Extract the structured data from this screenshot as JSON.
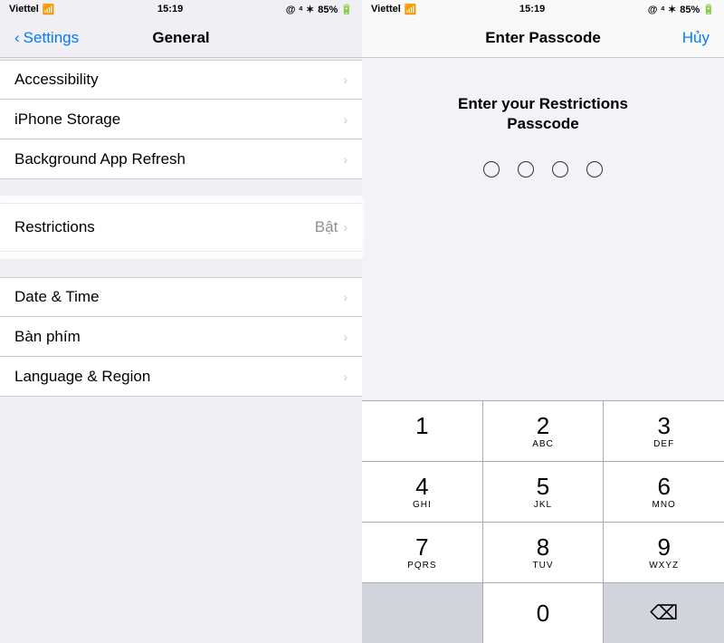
{
  "left": {
    "status": {
      "carrier": "Viettel",
      "time": "15:19",
      "icons": "@ ⁴ ✶ 85%"
    },
    "nav": {
      "back_label": "Settings",
      "title": "General"
    },
    "rows": [
      {
        "id": "accessibility",
        "label": "Accessibility",
        "value": "",
        "chevron": "›"
      },
      {
        "id": "iphone-storage",
        "label": "iPhone Storage",
        "value": "",
        "chevron": "›"
      },
      {
        "id": "background-refresh",
        "label": "Background App Refresh",
        "value": "",
        "chevron": "›"
      }
    ],
    "restrictions": {
      "label": "Restrictions",
      "value": "Bật",
      "chevron": "›"
    },
    "rows2": [
      {
        "id": "date-time",
        "label": "Date & Time",
        "value": "",
        "chevron": "›"
      },
      {
        "id": "keyboard",
        "label": "Bàn phím",
        "value": "",
        "chevron": "›"
      },
      {
        "id": "language",
        "label": "Language & Region",
        "value": "",
        "chevron": "›"
      }
    ]
  },
  "right": {
    "status": {
      "carrier": "Viettel",
      "time": "15:19",
      "icons": "@ ⁴ ✶ 85%"
    },
    "nav": {
      "title": "Enter Passcode",
      "cancel": "Hủy"
    },
    "prompt": "Enter your Restrictions\nPasscode",
    "dots": 4,
    "numpad": [
      [
        {
          "number": "1",
          "letters": ""
        },
        {
          "number": "2",
          "letters": "ABC"
        },
        {
          "number": "3",
          "letters": "DEF"
        }
      ],
      [
        {
          "number": "4",
          "letters": "GHI"
        },
        {
          "number": "5",
          "letters": "JKL"
        },
        {
          "number": "6",
          "letters": "MNO"
        }
      ],
      [
        {
          "number": "7",
          "letters": "PQRS"
        },
        {
          "number": "8",
          "letters": "TUV"
        },
        {
          "number": "9",
          "letters": "WXYZ"
        }
      ],
      [
        {
          "number": "",
          "letters": "",
          "type": "empty"
        },
        {
          "number": "0",
          "letters": ""
        },
        {
          "number": "⌫",
          "letters": "",
          "type": "backspace"
        }
      ]
    ]
  }
}
